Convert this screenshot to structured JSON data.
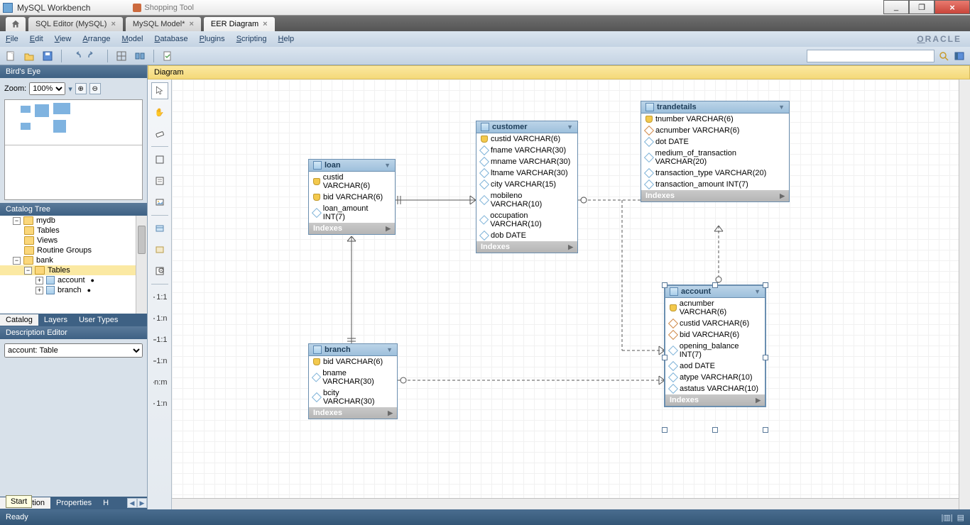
{
  "window": {
    "title": "MySQL Workbench",
    "browserTabTitle": "Shopping Tool"
  },
  "winbtns": {
    "min": "_",
    "max": "❐",
    "close": "×"
  },
  "docTabs": {
    "sqlEditor": "SQL Editor (MySQL)",
    "mysqlModel": "MySQL Model*",
    "eerDiagram": "EER Diagram"
  },
  "menu": {
    "file": "File",
    "edit": "Edit",
    "view": "View",
    "arrange": "Arrange",
    "model": "Model",
    "database": "Database",
    "plugins": "Plugins",
    "scripting": "Scripting",
    "help": "Help",
    "brand": "ORACLE"
  },
  "toolbar": {
    "searchPlaceholder": ""
  },
  "birdsEye": {
    "title": "Bird's Eye",
    "zoomLabel": "Zoom:",
    "zoomValue": "100%"
  },
  "catalog": {
    "title": "Catalog Tree",
    "mydb": "mydb",
    "tables": "Tables",
    "views": "Views",
    "routine": "Routine Groups",
    "bank": "bank",
    "account": "account",
    "branch": "branch",
    "dot": "●",
    "tabs": {
      "catalog": "Catalog",
      "layers": "Layers",
      "userTypes": "User Types"
    }
  },
  "descEditor": {
    "title": "Description Editor",
    "value": "account: Table",
    "tabs": {
      "description": "Description",
      "properties": "Properties",
      "h": "H"
    }
  },
  "diagram": {
    "title": "Diagram"
  },
  "tables": {
    "loan": {
      "name": "loan",
      "cols": [
        {
          "k": "pk",
          "t": "custid VARCHAR(6)"
        },
        {
          "k": "pk",
          "t": "bid VARCHAR(6)"
        },
        {
          "k": "attr",
          "t": "loan_amount INT(7)"
        }
      ]
    },
    "branch": {
      "name": "branch",
      "cols": [
        {
          "k": "pk",
          "t": "bid VARCHAR(6)"
        },
        {
          "k": "attr",
          "t": "bname VARCHAR(30)"
        },
        {
          "k": "attr",
          "t": "bcity VARCHAR(30)"
        }
      ]
    },
    "customer": {
      "name": "customer",
      "cols": [
        {
          "k": "pk",
          "t": "custid VARCHAR(6)"
        },
        {
          "k": "attr",
          "t": "fname VARCHAR(30)"
        },
        {
          "k": "attr",
          "t": "mname VARCHAR(30)"
        },
        {
          "k": "attr",
          "t": "ltname VARCHAR(30)"
        },
        {
          "k": "attr",
          "t": "city VARCHAR(15)"
        },
        {
          "k": "attr",
          "t": "mobileno VARCHAR(10)"
        },
        {
          "k": "attr",
          "t": "occupation VARCHAR(10)"
        },
        {
          "k": "attr",
          "t": "dob DATE"
        }
      ]
    },
    "trandetails": {
      "name": "trandetails",
      "cols": [
        {
          "k": "pk",
          "t": "tnumber VARCHAR(6)"
        },
        {
          "k": "fk",
          "t": "acnumber VARCHAR(6)"
        },
        {
          "k": "attr",
          "t": "dot DATE"
        },
        {
          "k": "attr",
          "t": "medium_of_transaction VARCHAR(20)"
        },
        {
          "k": "attr",
          "t": "transaction_type VARCHAR(20)"
        },
        {
          "k": "attr",
          "t": "transaction_amount INT(7)"
        }
      ]
    },
    "account": {
      "name": "account",
      "cols": [
        {
          "k": "pk",
          "t": "acnumber VARCHAR(6)"
        },
        {
          "k": "fk",
          "t": "custid VARCHAR(6)"
        },
        {
          "k": "fk",
          "t": "bid VARCHAR(6)"
        },
        {
          "k": "attr",
          "t": "opening_balance INT(7)"
        },
        {
          "k": "attr",
          "t": "aod DATE"
        },
        {
          "k": "attr",
          "t": "atype VARCHAR(10)"
        },
        {
          "k": "attr",
          "t": "astatus VARCHAR(10)"
        }
      ]
    }
  },
  "indexes": "Indexes",
  "status": {
    "ready": "Ready"
  },
  "startTip": "Start",
  "relLabels": {
    "oneone": "1:1",
    "onen": "1:n",
    "nm": "n:m",
    "doneone": "1:1",
    "donen": "1:n",
    "dnm": "1:n"
  }
}
